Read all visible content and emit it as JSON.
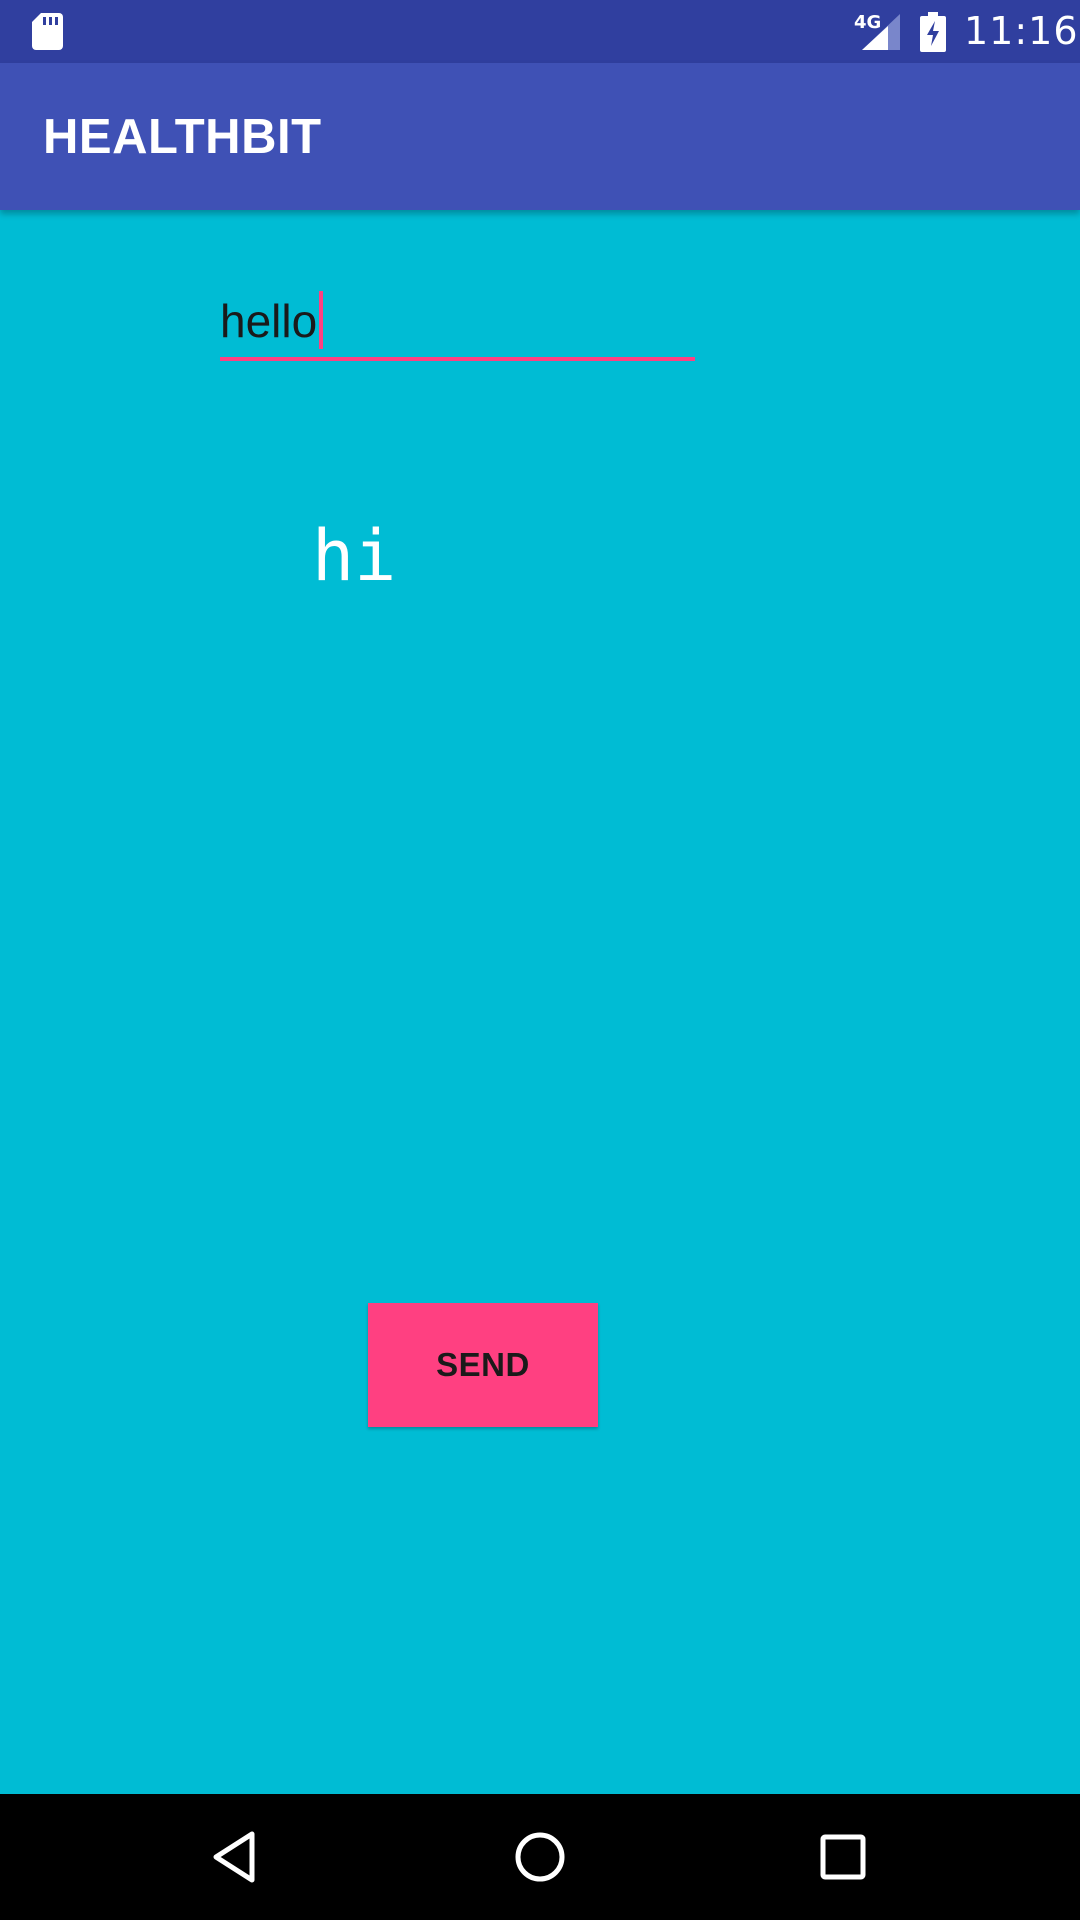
{
  "status_bar": {
    "time": "11:16",
    "network": "4G",
    "icons": [
      "sd-card-icon",
      "signal-icon",
      "battery-charging-icon"
    ]
  },
  "app_bar": {
    "title": "HEALTHBIT"
  },
  "message_input": {
    "value": "hello"
  },
  "reply": {
    "text": "hi"
  },
  "send_button": {
    "label": "SEND"
  },
  "nav_bar": {
    "icons": [
      "back-icon",
      "home-icon",
      "recents-icon"
    ]
  },
  "colors": {
    "status_bar": "#303F9F",
    "app_bar": "#3F51B5",
    "background": "#00BCD4",
    "accent": "#FF4081",
    "nav_bar": "#000000"
  }
}
